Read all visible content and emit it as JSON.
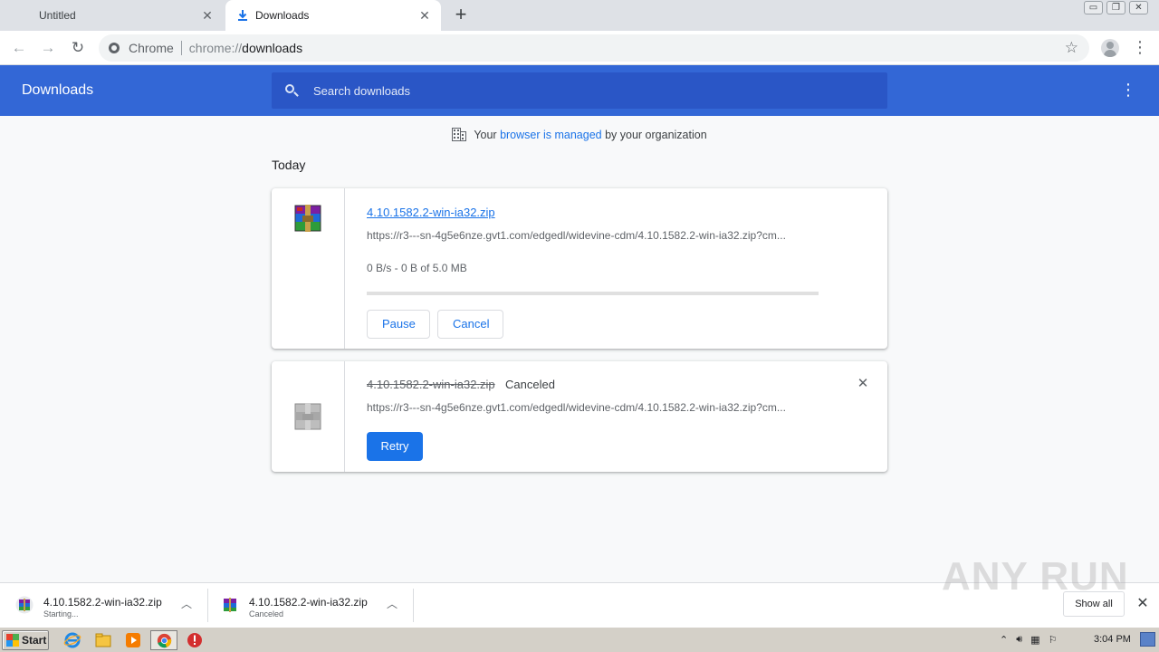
{
  "tabs": [
    {
      "title": "Untitled",
      "active": false
    },
    {
      "title": "Downloads",
      "active": true
    }
  ],
  "new_tab_symbol": "+",
  "window_controls": [
    "▭",
    "❐",
    "✕"
  ],
  "toolbar": {
    "back_icon": "←",
    "forward_icon": "→",
    "reload_icon": "↻",
    "origin_label": "Chrome",
    "url_scheme": "chrome://",
    "url_host": "downloads",
    "bookmark_icon": "☆",
    "menu_icon": "⋮"
  },
  "downloads_page": {
    "title": "Downloads",
    "search_placeholder": "Search downloads",
    "more_icon": "⋮",
    "managed_notice": {
      "prefix": "Your ",
      "link": "browser is managed",
      "suffix": " by your organization"
    },
    "section_label": "Today"
  },
  "downloads": [
    {
      "file_name": "4.10.1582.2-win-ia32.zip",
      "url": "https://r3---sn-4g5e6nze.gvt1.com/edgedl/widevine-cdm/4.10.1582.2-win-ia32.zip?cm...",
      "progress_text": "0 B/s - 0 B of 5.0 MB",
      "progress_fraction": 0,
      "buttons": {
        "pause": "Pause",
        "cancel": "Cancel"
      }
    },
    {
      "file_name": "4.10.1582.2-win-ia32.zip",
      "status": "Canceled",
      "url": "https://r3---sn-4g5e6nze.gvt1.com/edgedl/widevine-cdm/4.10.1582.2-win-ia32.zip?cm...",
      "buttons": {
        "retry": "Retry"
      },
      "remove_icon": "✕"
    }
  ],
  "shelf": {
    "items": [
      {
        "name": "4.10.1582.2-win-ia32.zip",
        "status": "Starting..."
      },
      {
        "name": "4.10.1582.2-win-ia32.zip",
        "status": "Canceled"
      }
    ],
    "show_all": "Show all",
    "close_icon": "✕",
    "watermark": "ANY RUN"
  },
  "taskbar": {
    "start_label": "Start",
    "clock": "3:04 PM"
  },
  "colors": {
    "header_blue": "#3367d6",
    "search_blue": "#2a56c6",
    "link_blue": "#1a73e8"
  }
}
